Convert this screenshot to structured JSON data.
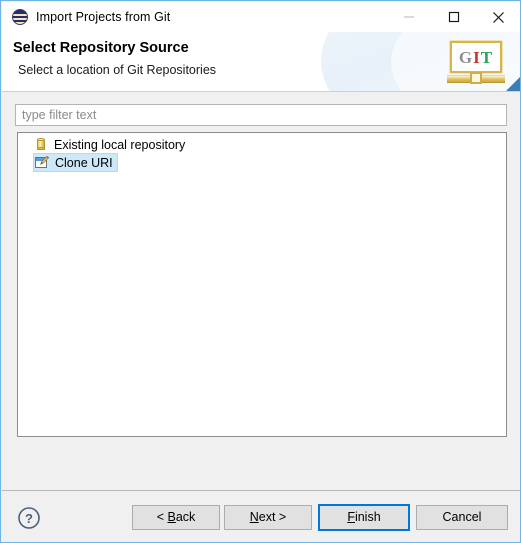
{
  "window": {
    "title": "Import Projects from Git",
    "app_icon": "eclipse-icon",
    "controls": {
      "minimize": "minimize-icon",
      "maximize": "maximize-icon",
      "close": "close-icon"
    }
  },
  "header": {
    "title": "Select Repository Source",
    "subtitle": "Select a location of Git Repositories",
    "banner": {
      "letters": [
        "G",
        "I",
        "T"
      ],
      "letter_colors": [
        "#8e8e8e",
        "#c0392b",
        "#2aa45a"
      ],
      "frame_color": "#d8b44a"
    }
  },
  "content": {
    "filter": {
      "value": "",
      "placeholder": "type filter text"
    },
    "tree": {
      "items": [
        {
          "label": "Existing local repository",
          "icon": "repository-cylinder-icon",
          "selected": false
        },
        {
          "label": "Clone URI",
          "icon": "clone-uri-icon",
          "selected": true
        }
      ]
    }
  },
  "footer": {
    "help": "help-icon",
    "buttons": [
      {
        "id": "back",
        "label": "< Back",
        "mnemonic": "B",
        "default": false,
        "enabled": true
      },
      {
        "id": "next",
        "label": "Next >",
        "mnemonic": "N",
        "default": false,
        "enabled": true
      },
      {
        "id": "finish",
        "label": "Finish",
        "mnemonic": "F",
        "default": true,
        "enabled": true
      },
      {
        "id": "cancel",
        "label": "Cancel",
        "mnemonic": "",
        "default": false,
        "enabled": true
      }
    ]
  },
  "colors": {
    "window_border": "#6CB5E6",
    "default_button_border": "#0078d7",
    "selection_highlight": "#cde8f9",
    "dialog_background": "#f0f0f0"
  }
}
